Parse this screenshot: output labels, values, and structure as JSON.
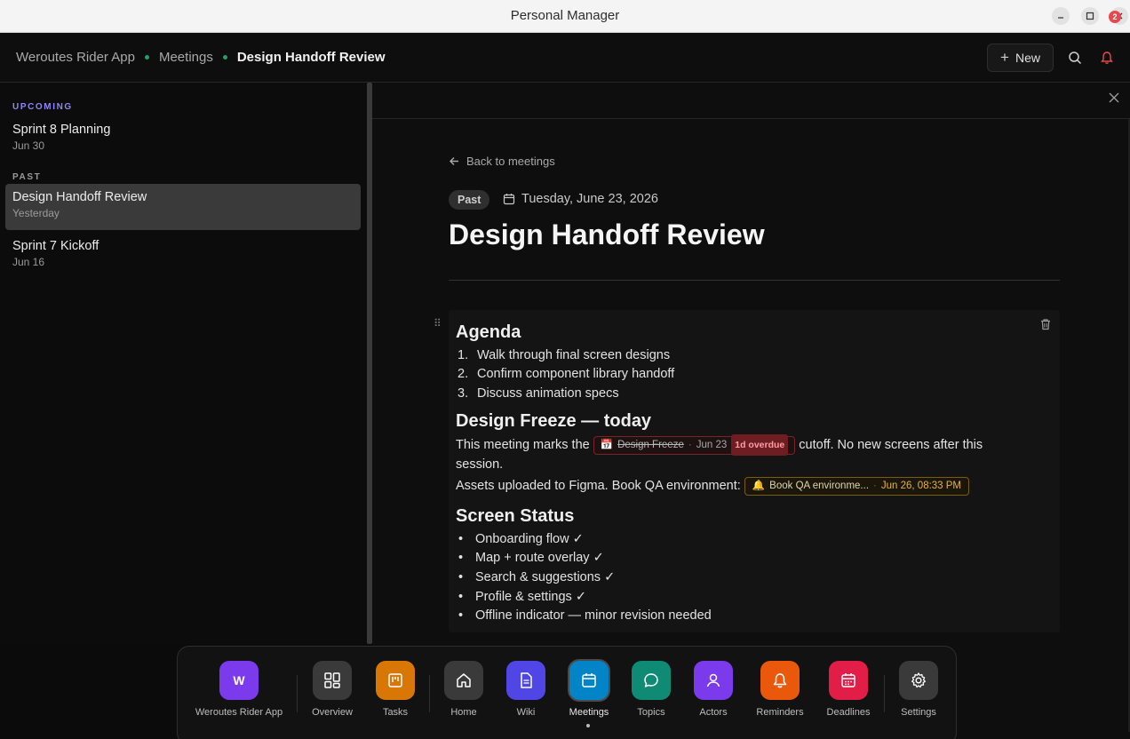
{
  "window": {
    "title": "Personal Manager"
  },
  "breadcrumb": [
    "Weroutes Rider App",
    "Meetings",
    "Design Handoff Review"
  ],
  "header": {
    "new_label": "New",
    "notification_count": "2"
  },
  "sidebar": {
    "upcoming_label": "UPCOMING",
    "past_label": "PAST",
    "upcoming": [
      {
        "title": "Sprint 8 Planning",
        "date": "Jun 30"
      }
    ],
    "past": [
      {
        "title": "Design Handoff Review",
        "date": "Yesterday"
      },
      {
        "title": "Sprint 7 Kickoff",
        "date": "Jun 16"
      }
    ]
  },
  "meeting": {
    "back_label": "Back to meetings",
    "status": "Past",
    "date": "Tuesday, June 23, 2026",
    "title": "Design Handoff Review"
  },
  "content": {
    "agenda_heading": "Agenda",
    "agenda": [
      {
        "n": "1.",
        "text": "Walk through final screen designs"
      },
      {
        "n": "2.",
        "text": "Confirm component library handoff"
      },
      {
        "n": "3.",
        "text": "Discuss animation specs"
      }
    ],
    "freeze_heading": "Design Freeze — today",
    "freeze_before": "This meeting marks the",
    "freeze_after": "cutoff. No new screens after this",
    "freeze_line2": "session.",
    "deadline_chip": {
      "icon": "📅",
      "name": "Design Freeze",
      "date": "Jun 23",
      "overdue": "1d overdue"
    },
    "assets_text": "Assets uploaded to Figma. Book QA environment:",
    "reminder_chip": {
      "icon": "🔔",
      "name": "Book QA environme...",
      "date": "Jun 26, 08:33 PM"
    },
    "status_heading": "Screen Status",
    "status_items": [
      "Onboarding flow ✓",
      "Map + route overlay ✓",
      "Search & suggestions ✓",
      "Profile & settings ✓",
      "Offline indicator — minor revision needed"
    ]
  },
  "dock": [
    {
      "label": "Weroutes Rider App",
      "glyph": "W",
      "color": "#7c3aed"
    },
    {
      "label": "Overview",
      "color": "#3a3a3a"
    },
    {
      "label": "Tasks",
      "color": "#d97706"
    },
    {
      "label": "Home",
      "color": "#3a3a3a"
    },
    {
      "label": "Wiki",
      "color": "#4f46e5"
    },
    {
      "label": "Meetings",
      "color": "#0284c7"
    },
    {
      "label": "Topics",
      "color": "#0f8a74"
    },
    {
      "label": "Actors",
      "color": "#7c3aed"
    },
    {
      "label": "Reminders",
      "color": "#ea580c"
    },
    {
      "label": "Deadlines",
      "color": "#e11d48"
    },
    {
      "label": "Settings",
      "color": "#3a3a3a"
    }
  ],
  "colors": {
    "accent_dot": "#22a06b",
    "badge": "#e5484d",
    "upcoming_label": "#8f86f0"
  }
}
